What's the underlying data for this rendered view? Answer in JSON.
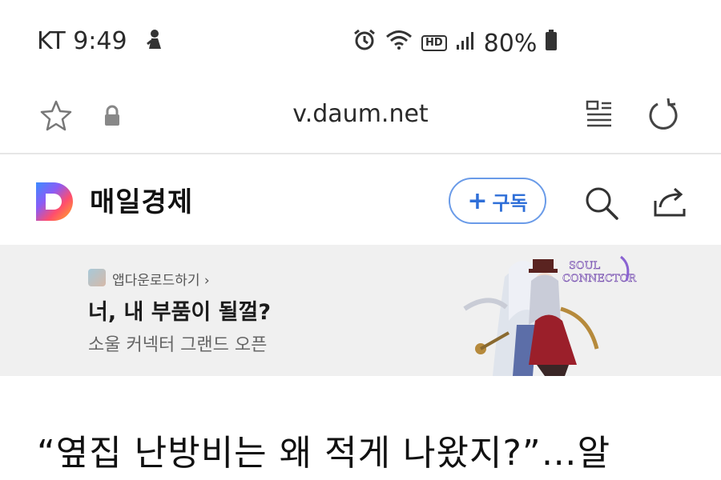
{
  "status_bar": {
    "carrier_time": "KT 9:49",
    "battery": "80%",
    "hd_badge": "HD"
  },
  "url_bar": {
    "url": "v.daum.net"
  },
  "site_header": {
    "publisher": "매일경제",
    "subscribe_label": "구독",
    "subscribe_plus": "+"
  },
  "ad": {
    "source": "앱다운로드하기 ›",
    "headline": "너, 내 부품이 될껄?",
    "subtext": "소울 커넥터 그랜드 오픈",
    "logo_text": "SOUL CONNECTOR"
  },
  "article": {
    "title": "“옆집 난방비는 왜 적게 나왔지?”…알"
  },
  "icons": {
    "status_left": "notification-icon",
    "alarm": "alarm-icon",
    "wifi": "wifi-icon",
    "signal": "signal-icon",
    "battery": "battery-icon",
    "bookmark": "star-icon",
    "lock": "lock-icon",
    "reader": "reader-mode-icon",
    "reload": "reload-icon",
    "logo": "daum-logo",
    "search": "search-icon",
    "share": "share-icon"
  },
  "colors": {
    "accent_blue": "#2f6fd8",
    "ad_background": "#f0f0f0"
  }
}
